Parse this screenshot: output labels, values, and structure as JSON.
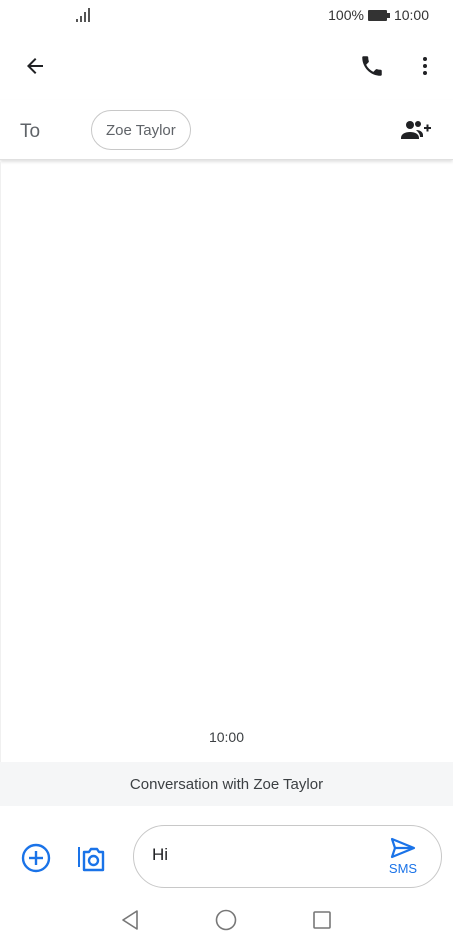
{
  "status_bar": {
    "battery": "100%",
    "time": "10:00"
  },
  "recipients": {
    "to_label": "To",
    "chips": [
      "Zoe Taylor"
    ]
  },
  "conversation": {
    "timestamp": "10:00",
    "banner": "Conversation with Zoe Taylor"
  },
  "compose": {
    "message_value": "Hi",
    "send_label": "SMS"
  },
  "colors": {
    "accent": "#1a73e8",
    "icon_dark": "#202124",
    "divider": "#e0e0e0",
    "banner_bg": "#f5f6f7"
  },
  "icons": {
    "back": "arrow-back-icon",
    "call": "phone-icon",
    "more": "more-vert-icon",
    "add_contact": "add-person-icon",
    "attach": "add-circle-icon",
    "camera": "camera-icon",
    "send": "send-icon"
  }
}
